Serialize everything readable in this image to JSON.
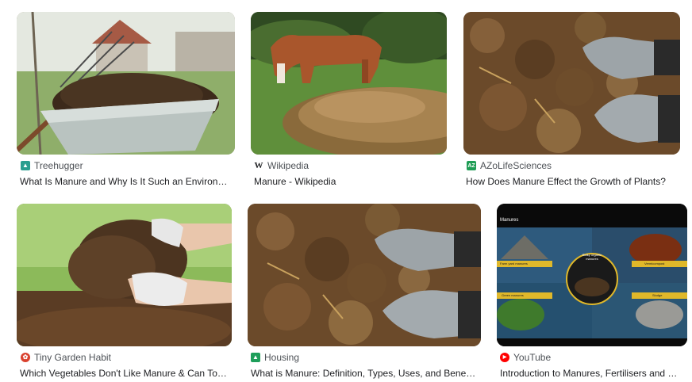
{
  "results": [
    {
      "source": "Treehugger",
      "title": "What Is Manure and Why Is It Such an Environ…",
      "favicon": "treehugger-icon",
      "favicon_color": "#2b9e8f"
    },
    {
      "source": "Wikipedia",
      "title": "Manure - Wikipedia",
      "favicon": "wikipedia-icon",
      "favicon_glyph": "W"
    },
    {
      "source": "AZoLifeSciences",
      "title": "How Does Manure Effect the Growth of Plants?",
      "favicon": "azolifesciences-icon",
      "favicon_color": "#1f9d55",
      "favicon_glyph": "AZ"
    },
    {
      "source": "Tiny Garden Habit",
      "title": "Which Vegetables Don't Like Manure & Can To…",
      "favicon": "tiny-garden-habit-icon",
      "favicon_color": "#d9412e"
    },
    {
      "source": "Housing",
      "title": "What is Manure: Definition, Types, Uses, and Bene…",
      "favicon": "housing-icon",
      "favicon_color": "#1e9e5a"
    },
    {
      "source": "YouTube",
      "title": "Introduction to Manures, Fertilisers and …",
      "favicon": "youtube-icon",
      "favicon_color": "#ff0000"
    }
  ],
  "youtube_thumb": {
    "heading": "Manures",
    "center": "Bulky organic manures",
    "labels": [
      "Farm yard manures",
      "Vermicompost",
      "Green manures",
      "Sludge"
    ]
  }
}
